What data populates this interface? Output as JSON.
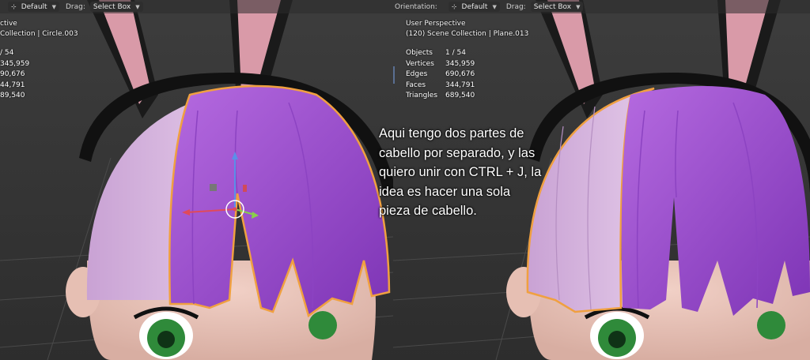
{
  "left_viewport": {
    "header": {
      "pivot_value": "Default",
      "drag_label": "Drag:",
      "drag_value": "Select Box"
    },
    "overlay": {
      "perspective": "ctive",
      "collection": "Collection | Circle.003"
    },
    "stats": {
      "objects": "/ 54",
      "vertices": "345,959",
      "edges": "90,676",
      "faces": "44,791",
      "triangles": "89,540"
    }
  },
  "right_viewport": {
    "header": {
      "orientation_label": "Orientation:",
      "pivot_value": "Default",
      "drag_label": "Drag:",
      "drag_value": "Select Box"
    },
    "overlay": {
      "perspective": "User Perspective",
      "collection": "(120) Scene Collection | Plane.013"
    },
    "stats": [
      {
        "label": "Objects",
        "value": "1 / 54"
      },
      {
        "label": "Vertices",
        "value": "345,959"
      },
      {
        "label": "Edges",
        "value": "690,676"
      },
      {
        "label": "Faces",
        "value": "344,791"
      },
      {
        "label": "Triangles",
        "value": "689,540"
      }
    ]
  },
  "annotation": {
    "lines": [
      "Aqui tengo dos partes de",
      "cabello por separado, y las",
      "quiero unir con CTRL + J, la",
      "idea es hacer una sola",
      "pieza de cabello."
    ]
  },
  "colors": {
    "hair_purple": "#a24fd2",
    "hair_light": "#d6b7dd",
    "selection_outline": "#f0a040",
    "ear_pink": "#d99aa8",
    "eye_green": "#2f8a3a",
    "background": "#3a3a3a"
  },
  "icons": {
    "pivot": "transform-pivot-icon",
    "dropdown": "chevron-down-icon"
  }
}
